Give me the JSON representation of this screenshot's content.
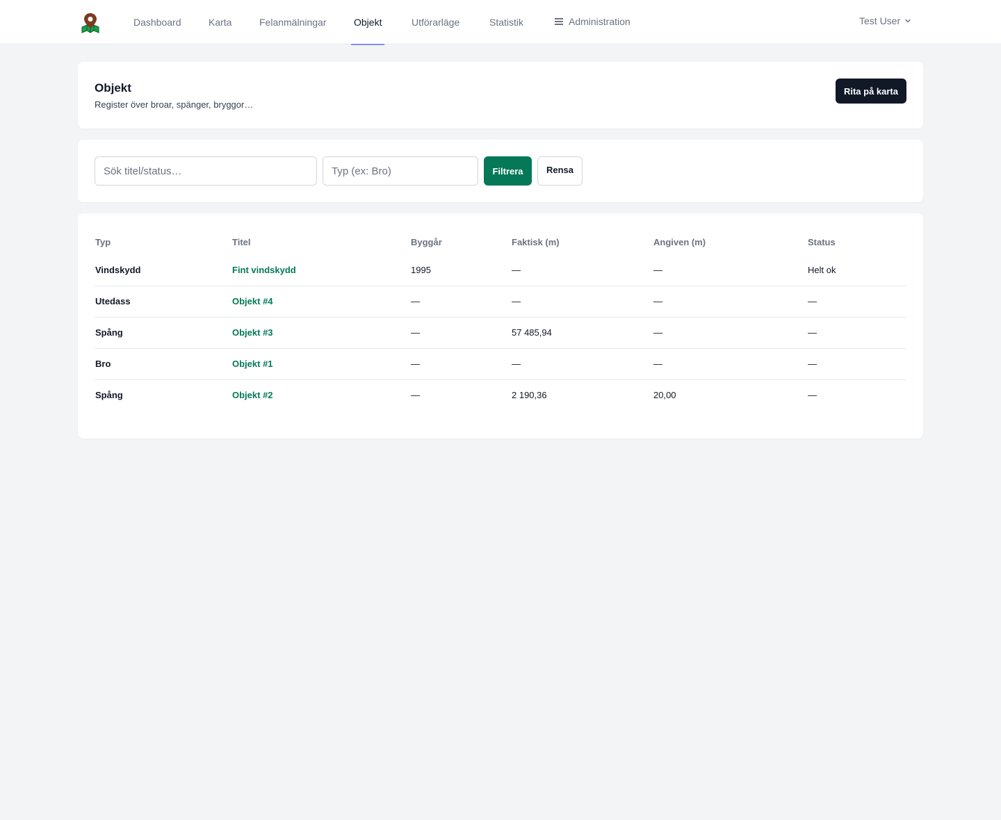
{
  "nav": {
    "items": [
      {
        "label": "Dashboard"
      },
      {
        "label": "Karta"
      },
      {
        "label": "Felanmälningar"
      },
      {
        "label": "Objekt"
      },
      {
        "label": "Utförarläge"
      },
      {
        "label": "Statistik"
      },
      {
        "label": "Administration"
      }
    ],
    "active": "Objekt",
    "user": "Test User",
    "logo_colors": {
      "pin": "#7c3a1e",
      "map": "#16a34a"
    }
  },
  "header": {
    "title": "Objekt",
    "subtitle": "Register över broar, spänger, bryggor…",
    "draw_button": "Rita på karta"
  },
  "filter": {
    "search_placeholder": "Sök titel/status…",
    "search_value": "",
    "type_placeholder": "Typ (ex: Bro)",
    "type_value": "",
    "filter_button": "Filtrera",
    "clear_button": "Rensa"
  },
  "table": {
    "columns": [
      "Typ",
      "Titel",
      "Byggår",
      "Faktisk (m)",
      "Angiven (m)",
      "Status"
    ],
    "rows": [
      {
        "type": "Vindskydd",
        "title": "Fint vindskydd",
        "year": "1995",
        "actual": "—",
        "stated": "—",
        "status": "Helt ok"
      },
      {
        "type": "Utedass",
        "title": "Objekt #4",
        "year": "—",
        "actual": "—",
        "stated": "—",
        "status": "—"
      },
      {
        "type": "Spång",
        "title": "Objekt #3",
        "year": "—",
        "actual": "57 485,94",
        "stated": "—",
        "status": "—"
      },
      {
        "type": "Bro",
        "title": "Objekt #1",
        "year": "—",
        "actual": "—",
        "stated": "—",
        "status": "—"
      },
      {
        "type": "Spång",
        "title": "Objekt #2",
        "year": "—",
        "actual": "2 190,36",
        "stated": "20,00",
        "status": "—"
      }
    ]
  },
  "colors": {
    "accent_green": "#047857",
    "dark_button": "#111827",
    "active_underline": "#818cf8",
    "background": "#f3f4f6"
  }
}
